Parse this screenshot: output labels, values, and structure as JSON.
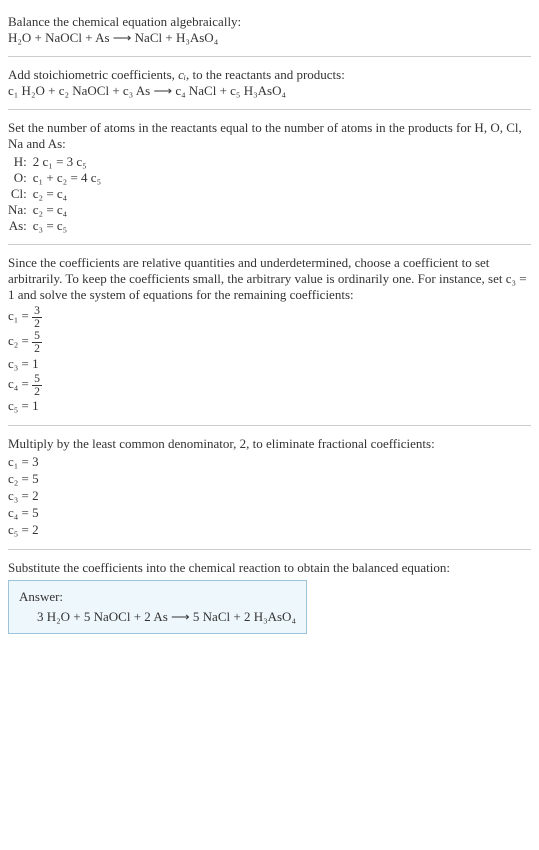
{
  "section1": {
    "prompt": "Balance the chemical equation algebraically:",
    "equation": "H₂O + NaOCl + As ⟶ NaCl + H₃AsO₄"
  },
  "section2": {
    "prompt_a": "Add stoichiometric coefficients, ",
    "prompt_ci": "cᵢ",
    "prompt_b": ", to the reactants and products:",
    "equation": "c₁ H₂O + c₂ NaOCl + c₃ As ⟶ c₄ NaCl + c₅ H₃AsO₄"
  },
  "section3": {
    "prompt": "Set the number of atoms in the reactants equal to the number of atoms in the products for H, O, Cl, Na and As:",
    "rows": [
      {
        "label": "H:",
        "eq": "2 c₁ = 3 c₅"
      },
      {
        "label": "O:",
        "eq": "c₁ + c₂ = 4 c₅"
      },
      {
        "label": "Cl:",
        "eq": "c₂ = c₄"
      },
      {
        "label": "Na:",
        "eq": "c₂ = c₄"
      },
      {
        "label": "As:",
        "eq": "c₃ = c₅"
      }
    ]
  },
  "section4": {
    "prompt": "Since the coefficients are relative quantities and underdetermined, choose a coefficient to set arbitrarily. To keep the coefficients small, the arbitrary value is ordinarily one. For instance, set c₃ = 1 and solve the system of equations for the remaining coefficients:",
    "c1": {
      "lhs": "c₁ = ",
      "num": "3",
      "den": "2"
    },
    "c2": {
      "lhs": "c₂ = ",
      "num": "5",
      "den": "2"
    },
    "c3": "c₃ = 1",
    "c4": {
      "lhs": "c₄ = ",
      "num": "5",
      "den": "2"
    },
    "c5": "c₅ = 1"
  },
  "section5": {
    "prompt": "Multiply by the least common denominator, 2, to eliminate fractional coefficients:",
    "lines": [
      "c₁ = 3",
      "c₂ = 5",
      "c₃ = 2",
      "c₄ = 5",
      "c₅ = 2"
    ]
  },
  "section6": {
    "prompt": "Substitute the coefficients into the chemical reaction to obtain the balanced equation:",
    "answer_label": "Answer:",
    "answer_eq": "3 H₂O + 5 NaOCl + 2 As ⟶ 5 NaCl + 2 H₃AsO₄"
  },
  "chart_data": {
    "type": "table",
    "title": "Chemical equation balancing",
    "unbalanced": "H2O + NaOCl + As -> NaCl + H3AsO4",
    "elements": [
      "H",
      "O",
      "Cl",
      "Na",
      "As"
    ],
    "atom_balance_equations": {
      "H": "2 c1 = 3 c5",
      "O": "c1 + c2 = 4 c5",
      "Cl": "c2 = c4",
      "Na": "c2 = c4",
      "As": "c3 = c5"
    },
    "solution_with_c3_1": {
      "c1": 1.5,
      "c2": 2.5,
      "c3": 1,
      "c4": 2.5,
      "c5": 1
    },
    "lcm": 2,
    "integer_coefficients": {
      "c1": 3,
      "c2": 5,
      "c3": 2,
      "c4": 5,
      "c5": 2
    },
    "balanced": "3 H2O + 5 NaOCl + 2 As -> 5 NaCl + 2 H3AsO4"
  }
}
